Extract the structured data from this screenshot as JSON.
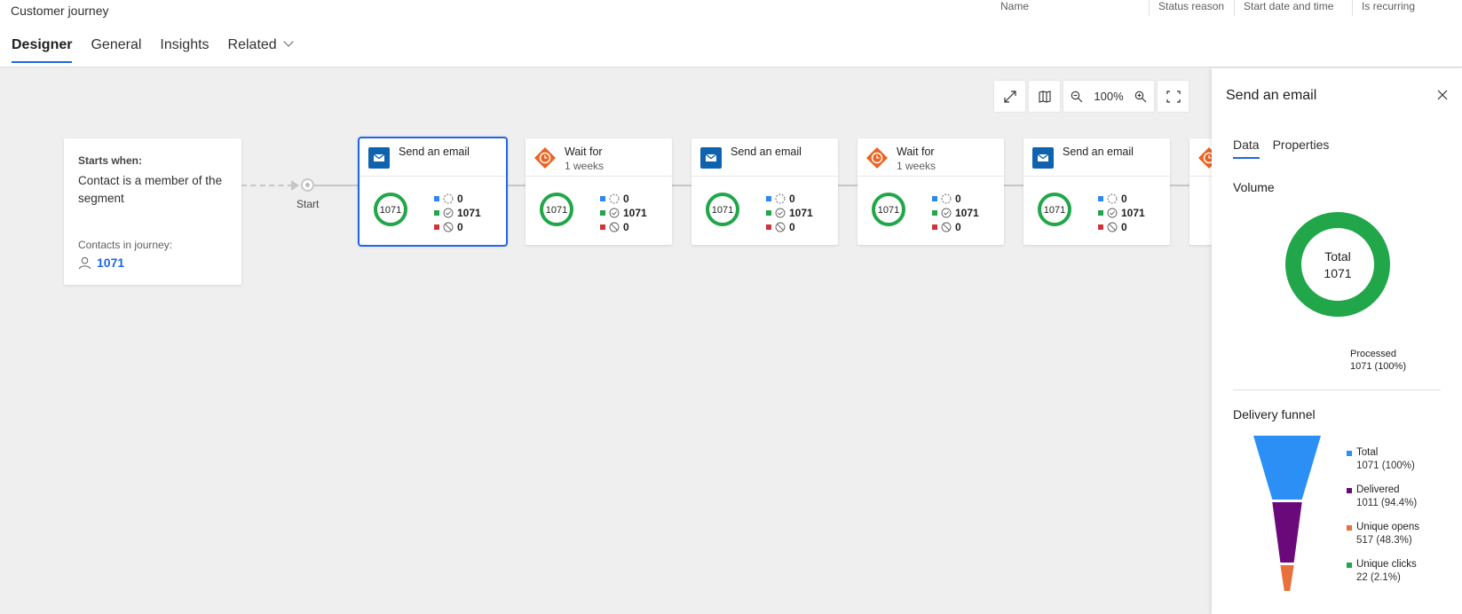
{
  "app": {
    "title": "Customer journey",
    "header_columns": [
      "Name",
      "Status reason",
      "Start date and time",
      "Is recurring"
    ]
  },
  "tabs": [
    {
      "label": "Designer",
      "active": true
    },
    {
      "label": "General",
      "active": false
    },
    {
      "label": "Insights",
      "active": false
    },
    {
      "label": "Related",
      "active": false,
      "has_dropdown": true
    }
  ],
  "toolbar": {
    "expand_icon": "expand-icon",
    "map_icon": "map-icon",
    "zoom_out_icon": "zoom-out-icon",
    "zoom_level": "100%",
    "zoom_in_icon": "zoom-in-icon",
    "fit_icon": "fit-to-screen-icon"
  },
  "trigger": {
    "label": "Starts when:",
    "condition": "Contact is a member of the segment",
    "contacts_label": "Contacts in journey:",
    "contacts_count": "1071",
    "start_label": "Start"
  },
  "tiles": [
    {
      "type": "email",
      "title": "Send an email",
      "subtitle": "",
      "total": "1071",
      "pending": "0",
      "processed": "1071",
      "stopped": "0",
      "selected": true
    },
    {
      "type": "wait",
      "title": "Wait for",
      "subtitle": "1 weeks",
      "total": "1071",
      "pending": "0",
      "processed": "1071",
      "stopped": "0",
      "selected": false
    },
    {
      "type": "email",
      "title": "Send an email",
      "subtitle": "",
      "total": "1071",
      "pending": "0",
      "processed": "1071",
      "stopped": "0",
      "selected": false
    },
    {
      "type": "wait",
      "title": "Wait for",
      "subtitle": "1 weeks",
      "total": "1071",
      "pending": "0",
      "processed": "1071",
      "stopped": "0",
      "selected": false
    },
    {
      "type": "email",
      "title": "Send an email",
      "subtitle": "",
      "total": "1071",
      "pending": "0",
      "processed": "1071",
      "stopped": "0",
      "selected": false
    },
    {
      "type": "wait",
      "title": "",
      "subtitle": "",
      "total": "",
      "pending": "",
      "processed": "",
      "stopped": "",
      "selected": false
    }
  ],
  "status_colors": {
    "pending": "#2b88f0",
    "processed": "#21a649",
    "stopped": "#d13438"
  },
  "panel": {
    "title": "Send an email",
    "tabs": [
      {
        "label": "Data",
        "active": true
      },
      {
        "label": "Properties",
        "active": false
      }
    ],
    "volume": {
      "heading": "Volume",
      "center_label": "Total",
      "center_value": "1071",
      "segments": [
        {
          "label": "Processed",
          "value": "1071 (100%)",
          "fraction": 1.0,
          "color": "#21a649"
        }
      ]
    },
    "funnel": {
      "heading": "Delivery funnel",
      "stages": [
        {
          "label": "Total",
          "value": "1071 (100%)",
          "count": 1071,
          "color": "#2b8ff5"
        },
        {
          "label": "Delivered",
          "value": "1011 (94.4%)",
          "count": 1011,
          "color": "#6a0a7a"
        },
        {
          "label": "Unique opens",
          "value": "517 (48.3%)",
          "count": 517,
          "color": "#e8703a"
        },
        {
          "label": "Unique clicks",
          "value": "22 (2.1%)",
          "count": 22,
          "color": "#21a649"
        }
      ]
    }
  }
}
